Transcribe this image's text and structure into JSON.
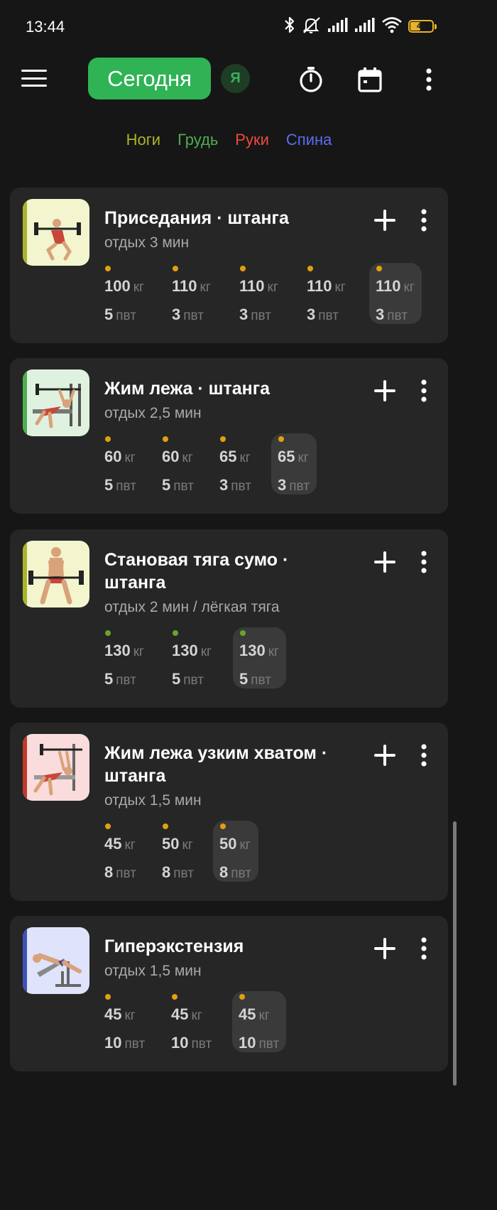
{
  "status_bar": {
    "time": "13:44",
    "battery": "44",
    "battery_level": 0.44,
    "icons": [
      "bluetooth-icon",
      "mute-icon",
      "signal-icon",
      "signal-icon",
      "wifi-icon",
      "battery-icon"
    ]
  },
  "appbar": {
    "today_label": "Сегодня",
    "avatar_letter": "Я",
    "icons": [
      "menu-icon",
      "stopwatch-icon",
      "calendar-icon",
      "more-vert-icon"
    ]
  },
  "filters": [
    {
      "label": "Ноги",
      "color": "#a8b52a"
    },
    {
      "label": "Грудь",
      "color": "#4caf50"
    },
    {
      "label": "Руки",
      "color": "#f04a3c"
    },
    {
      "label": "Спина",
      "color": "#5b6cf0"
    }
  ],
  "units": {
    "weight": "кг",
    "reps": "пвт"
  },
  "exercises": [
    {
      "title": "Приседания · штанга",
      "rest": "отдых 3 мин",
      "accent": "#a8b52a",
      "thumb_bg": "#f3f5cf",
      "dot_color": "#e0a010",
      "sets": [
        {
          "weight": "100",
          "reps": "5"
        },
        {
          "weight": "110",
          "reps": "3"
        },
        {
          "weight": "110",
          "reps": "3"
        },
        {
          "weight": "110",
          "reps": "3"
        },
        {
          "weight": "110",
          "reps": "3"
        }
      ]
    },
    {
      "title": "Жим лежа · штанга",
      "rest": "отдых 2,5 мин",
      "accent": "#4caf50",
      "thumb_bg": "#dff2df",
      "dot_color": "#e0a010",
      "sets": [
        {
          "weight": "60",
          "reps": "5"
        },
        {
          "weight": "60",
          "reps": "5"
        },
        {
          "weight": "65",
          "reps": "3"
        },
        {
          "weight": "65",
          "reps": "3"
        }
      ]
    },
    {
      "title": "Становая тяга сумо · штанга",
      "rest": "отдых 2 мин / лёгкая тяга",
      "accent": "#a8b52a",
      "thumb_bg": "#f3f5cf",
      "dot_color": "#6aa52a",
      "sets": [
        {
          "weight": "130",
          "reps": "5"
        },
        {
          "weight": "130",
          "reps": "5"
        },
        {
          "weight": "130",
          "reps": "5"
        }
      ]
    },
    {
      "title": "Жим лежа узким хватом · штанга",
      "rest": "отдых 1,5 мин",
      "accent": "#c0392b",
      "thumb_bg": "#fbdcdc",
      "dot_color": "#e0a010",
      "sets": [
        {
          "weight": "45",
          "reps": "8"
        },
        {
          "weight": "50",
          "reps": "8"
        },
        {
          "weight": "50",
          "reps": "8"
        }
      ]
    },
    {
      "title": "Гиперэкстензия",
      "rest": "отдых 1,5 мин",
      "accent": "#3f51b5",
      "thumb_bg": "#dfe3fb",
      "dot_color": "#e0a010",
      "sets": [
        {
          "weight": "45",
          "reps": "10"
        },
        {
          "weight": "45",
          "reps": "10"
        },
        {
          "weight": "45",
          "reps": "10"
        }
      ]
    }
  ]
}
